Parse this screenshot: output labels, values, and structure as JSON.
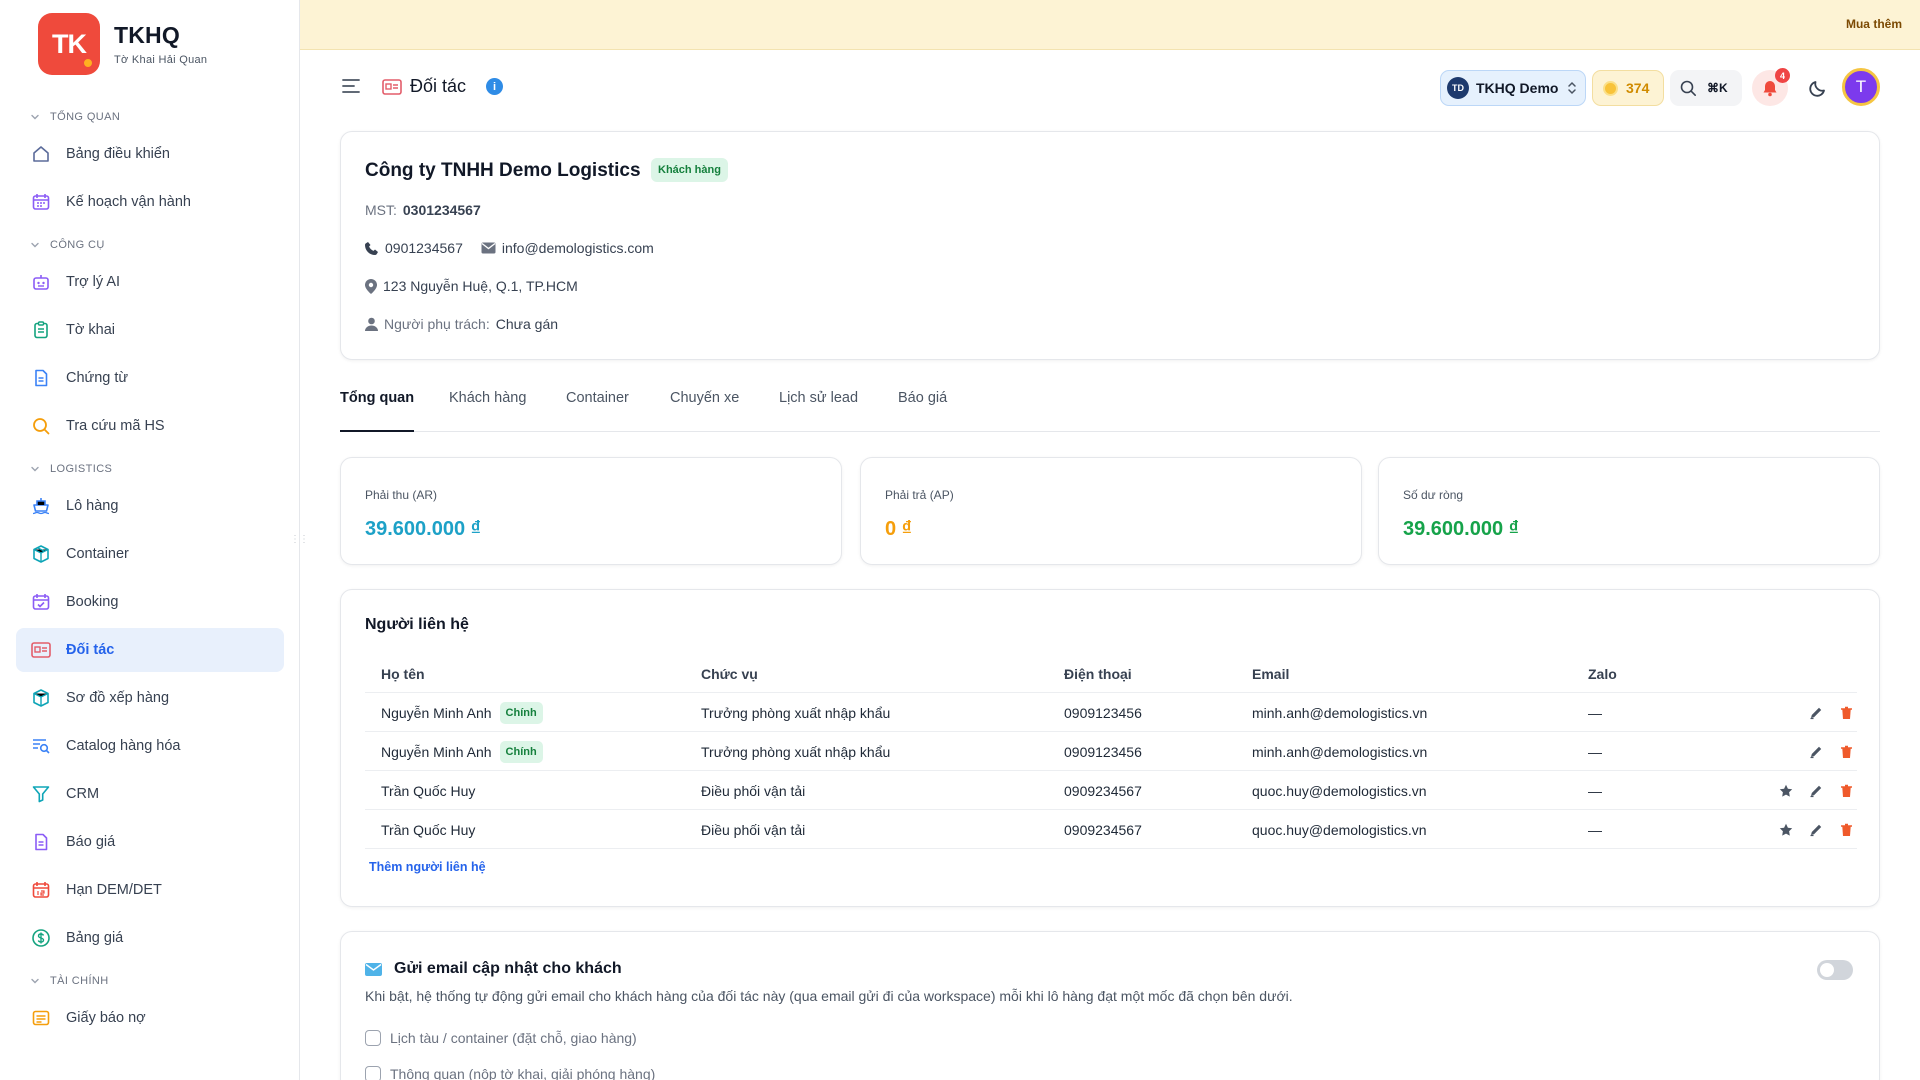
{
  "brand": {
    "logo_text": "TK",
    "title": "TKHQ",
    "subtitle": "Tờ Khai Hải Quan"
  },
  "sidebar": {
    "sections": [
      {
        "label": "TỔNG QUAN",
        "items": [
          {
            "label": "Bảng điều khiển",
            "icon": "home-icon"
          },
          {
            "label": "Kế hoạch vận hành",
            "icon": "calendar-icon"
          }
        ]
      },
      {
        "label": "CÔNG CỤ",
        "items": [
          {
            "label": "Trợ lý AI",
            "icon": "robot-icon"
          },
          {
            "label": "Tờ khai",
            "icon": "clipboard-icon"
          },
          {
            "label": "Chứng từ",
            "icon": "document-icon"
          },
          {
            "label": "Tra cứu mã HS",
            "icon": "search-icon"
          }
        ]
      },
      {
        "label": "LOGISTICS",
        "items": [
          {
            "label": "Lô hàng",
            "icon": "shipment-icon"
          },
          {
            "label": "Container",
            "icon": "box-icon"
          },
          {
            "label": "Booking",
            "icon": "calendar-check-icon"
          },
          {
            "label": "Đối tác",
            "icon": "id-card-icon",
            "active": true
          },
          {
            "label": "Sơ đồ xếp hàng",
            "icon": "cube-icon"
          },
          {
            "label": "Catalog hàng hóa",
            "icon": "list-search-icon"
          },
          {
            "label": "CRM",
            "icon": "funnel-icon"
          },
          {
            "label": "Báo giá",
            "icon": "quote-document-icon"
          },
          {
            "label": "Hạn DEM/DET",
            "icon": "calendar-date-icon"
          },
          {
            "label": "Bảng giá",
            "icon": "dollar-circle-icon"
          }
        ]
      },
      {
        "label": "TÀI CHÍNH",
        "items": [
          {
            "label": "Giấy báo nợ",
            "icon": "receipt-icon"
          }
        ]
      }
    ]
  },
  "banner": {
    "button_label": "Mua thêm"
  },
  "header": {
    "title": "Đối tác",
    "workspace": {
      "initials": "TD",
      "name": "TKHQ Demo"
    },
    "credits": "374",
    "search_shortcut": "⌘K",
    "notification_count": "4",
    "user_initial": "T"
  },
  "company": {
    "name": "Công ty TNHH Demo Logistics",
    "badge": "Khách hàng",
    "tax_label": "MST:",
    "tax_id": "0301234567",
    "phone": "0901234567",
    "email": "info@demologistics.com",
    "address": "123 Nguyễn Huệ, Q.1, TP.HCM",
    "owner_label": "Người phụ trách:",
    "owner_value": "Chưa gán"
  },
  "tabs": [
    "Tổng quan",
    "Khách hàng",
    "Container",
    "Chuyến xe",
    "Lịch sử lead",
    "Báo giá"
  ],
  "stats": [
    {
      "label": "Phải thu (AR)",
      "value": "39.600.000 ₫",
      "color": "#1da1c7"
    },
    {
      "label": "Phải trả (AP)",
      "value": "0 ₫",
      "color": "#f59e0b"
    },
    {
      "label": "Số dư ròng",
      "value": "39.600.000 ₫",
      "color": "#16a34a"
    }
  ],
  "contacts": {
    "title": "Người liên hệ",
    "columns": [
      "Họ tên",
      "Chức vụ",
      "Điện thoại",
      "Email",
      "Zalo"
    ],
    "rows": [
      {
        "name": "Nguyễn Minh Anh",
        "primary": "Chính",
        "position": "Trưởng phòng xuất nhập khẩu",
        "phone": "0909123456",
        "email": "minh.anh@demologistics.vn",
        "zalo": "—"
      },
      {
        "name": "Nguyễn Minh Anh",
        "primary": "Chính",
        "position": "Trưởng phòng xuất nhập khẩu",
        "phone": "0909123456",
        "email": "minh.anh@demologistics.vn",
        "zalo": "—"
      },
      {
        "name": "Trần Quốc Huy",
        "primary": "",
        "position": "Điều phối vận tải",
        "phone": "0909234567",
        "email": "quoc.huy@demologistics.vn",
        "zalo": "—"
      },
      {
        "name": "Trần Quốc Huy",
        "primary": "",
        "position": "Điều phối vận tải",
        "phone": "0909234567",
        "email": "quoc.huy@demologistics.vn",
        "zalo": "—"
      }
    ],
    "add_label": "Thêm người liên hệ"
  },
  "email_updates": {
    "title": "Gửi email cập nhật cho khách",
    "description": "Khi bật, hệ thống tự động gửi email cho khách hàng của đối tác này (qua email gửi đi của workspace) mỗi khi lô hàng đạt một mốc đã chọn bên dưới.",
    "enabled": false,
    "options": [
      "Lịch tàu / container (đặt chỗ, giao hàng)",
      "Thông quan (nộp tờ khai, giải phóng hàng)"
    ]
  }
}
